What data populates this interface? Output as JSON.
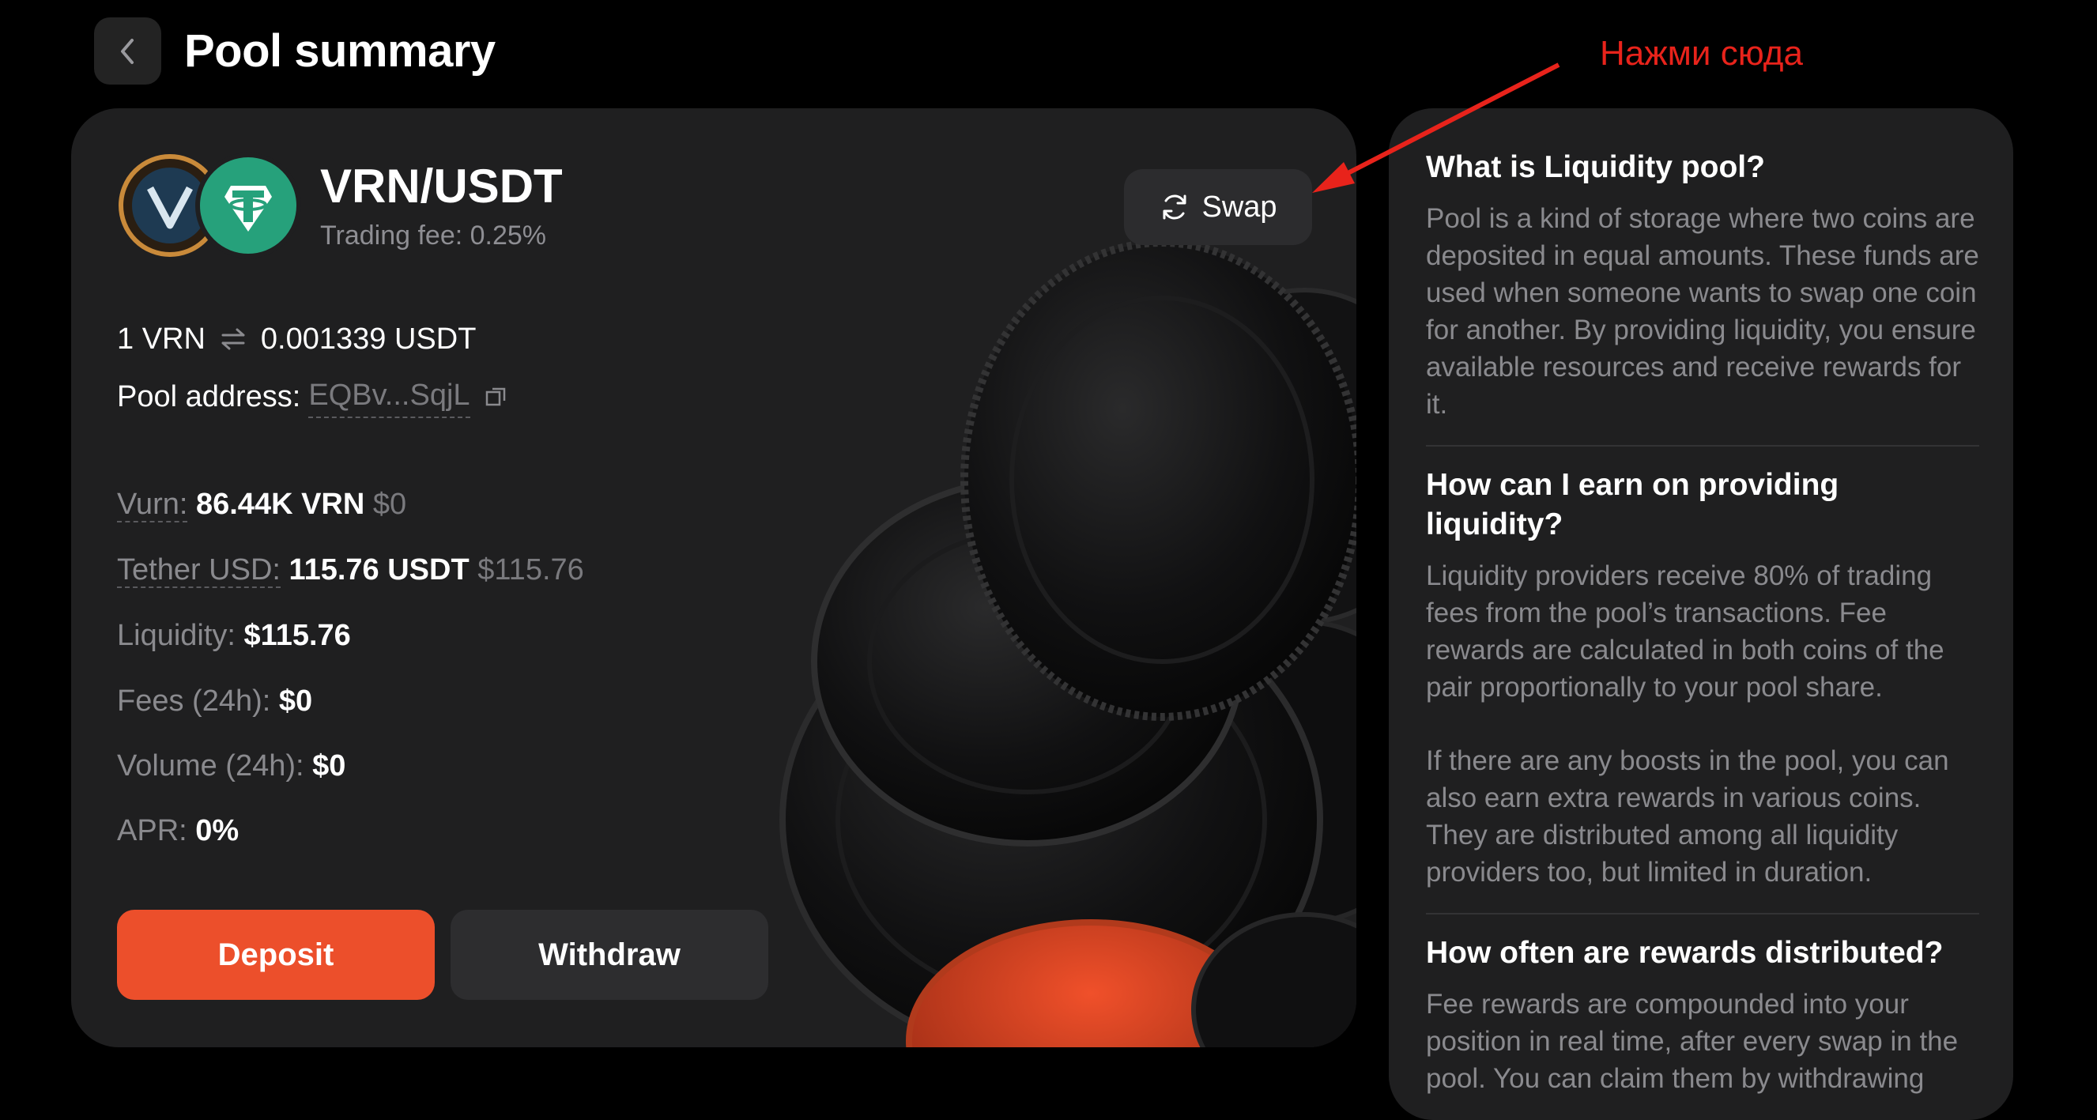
{
  "header": {
    "back_icon": "chevron-left-icon",
    "title": "Pool summary"
  },
  "annotation": {
    "text": "Нажми сюда",
    "color": "#e8231b"
  },
  "pool": {
    "pair": "VRN/USDT",
    "trading_fee": "Trading fee: 0.25%",
    "swap_label": "Swap",
    "rate_left": "1 VRN",
    "rate_right": "0.001339 USDT",
    "address_label": "Pool address:",
    "address_value": "EQBv...SqjL",
    "stats": [
      {
        "label": "Vurn:",
        "value": "86.44K VRN",
        "usd": "$0"
      },
      {
        "label": "Tether USD:",
        "value": "115.76 USDT",
        "usd": "$115.76"
      },
      {
        "label": "Liquidity:",
        "value": "$115.76"
      },
      {
        "label": "Fees (24h):",
        "value": "$0"
      },
      {
        "label": "Volume (24h):",
        "value": "$0"
      },
      {
        "label": "APR:",
        "value": "0%"
      }
    ],
    "deposit_label": "Deposit",
    "withdraw_label": "Withdraw"
  },
  "faq": [
    {
      "question": "What is Liquidity pool?",
      "answer": "Pool is a kind of storage where two coins are deposited in equal amounts. These funds are used when someone wants to swap one coin for another. By providing liquidity, you ensure available resources and receive rewards for it."
    },
    {
      "question": "How can I earn on providing liquidity?",
      "answer": "Liquidity providers receive 80% of trading fees from the pool’s transactions. Fee rewards are calculated in both coins of the pair proportionally to your pool share.",
      "answer2": "If there are any boosts in the pool, you can also earn extra rewards in various coins. They are distributed among all liquidity providers too, but limited in duration."
    },
    {
      "question": "How often are rewards distributed?",
      "answer": "Fee rewards are compounded into your position in real time, after every swap in the pool. You can claim them by withdrawing"
    }
  ],
  "colors": {
    "accent": "#ec4f2b",
    "background": "#000000",
    "card": "#1f1f20"
  }
}
